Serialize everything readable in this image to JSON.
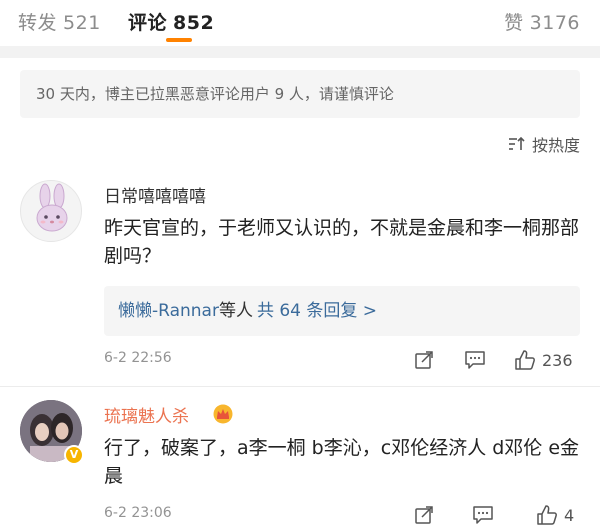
{
  "tabs": {
    "repost": {
      "label": "转发",
      "count": "521"
    },
    "comment": {
      "label": "评论",
      "count": "852"
    },
    "like": {
      "label": "赞",
      "count": "3176"
    }
  },
  "notice": "30 天内，博主已拉黑恶意评论用户 9 人，请谨慎评论",
  "sort": {
    "label": "按热度",
    "icon": "sort-icon"
  },
  "comments": [
    {
      "username": "日常嘻嘻嘻嘻",
      "avatar_icon": "bunny-avatar",
      "content": "昨天官宣的，于老师又认识的，不就是金晨和李一桐那部剧吗？",
      "replies": {
        "who": "懒懒-Rannar",
        "etc": "等人",
        "count": "共 64 条回复 >"
      },
      "time": "6-2 22:56",
      "like_count": "236"
    },
    {
      "username": "琉璃魅人杀",
      "avatar_icon": "photo-avatar",
      "badge": "V",
      "badge_icon": "crown-icon",
      "content": "行了，破案了，a李一桐 b李沁，c邓伦经济人 d邓伦  e金晨",
      "time": "6-2 23:06",
      "like_count": "4"
    }
  ],
  "colors": {
    "accent": "#ff8200",
    "username_vip": "#eb7350",
    "link": "#3b6b9b",
    "muted": "#939393"
  }
}
